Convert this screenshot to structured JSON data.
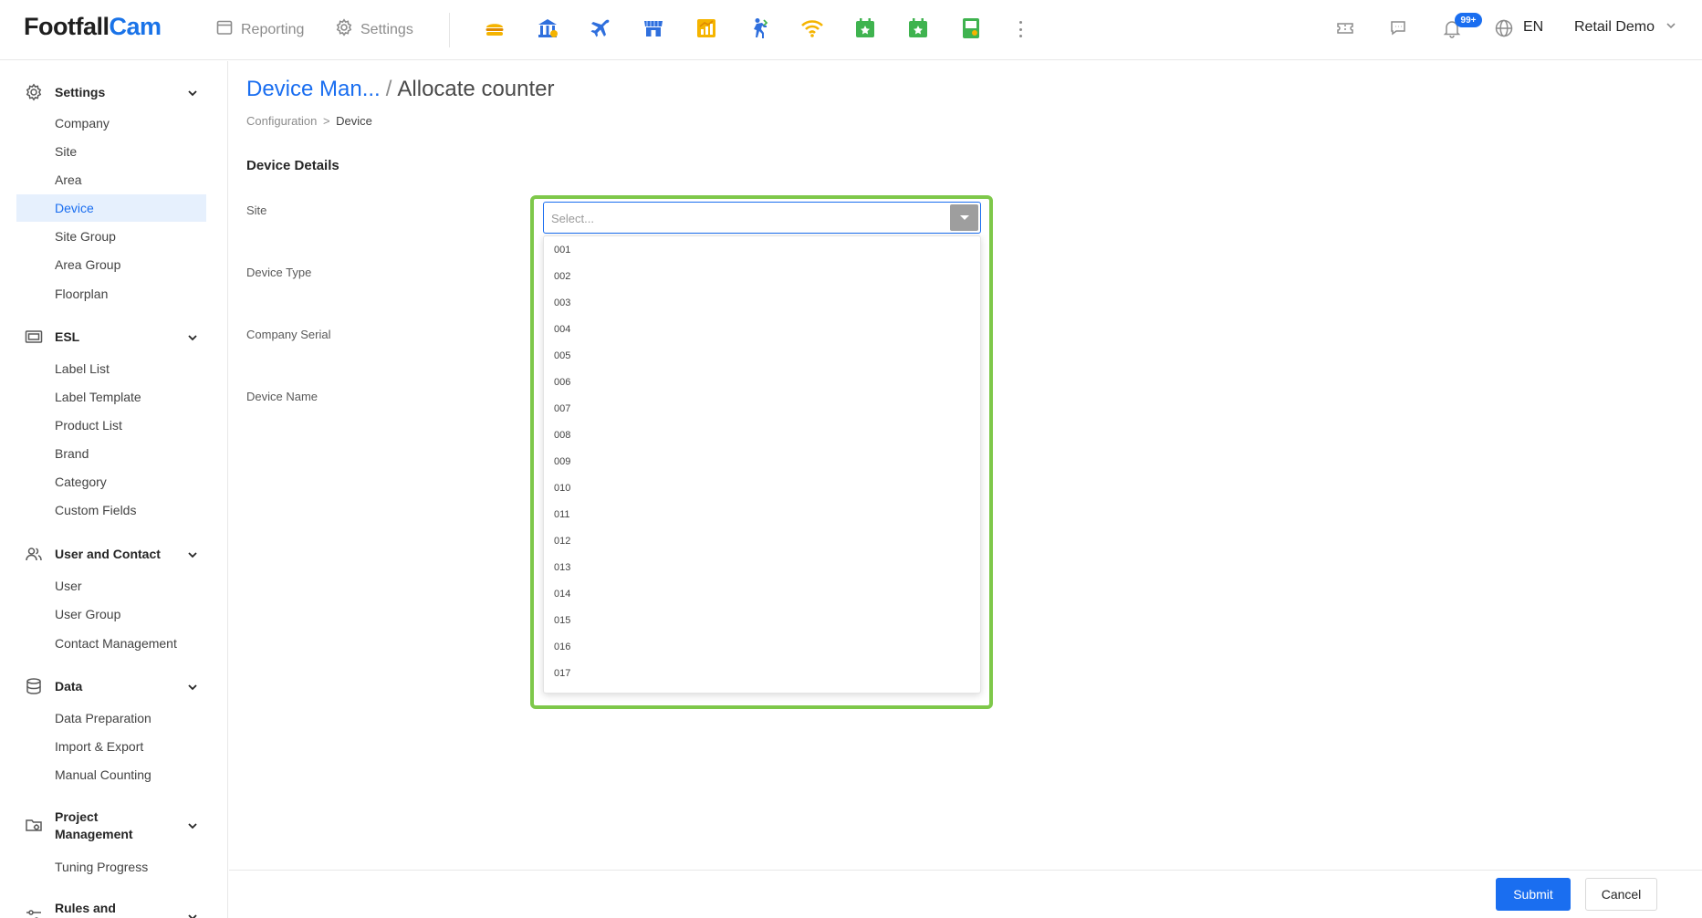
{
  "brand": {
    "part1": "Footfall",
    "part2": "Cam"
  },
  "topnav": {
    "reporting": "Reporting",
    "settings": "Settings"
  },
  "app_icons": [
    "burger-app-icon",
    "bank-app-icon",
    "airplane-app-icon",
    "store-app-icon",
    "chart-app-icon",
    "person-counter-app-icon",
    "wifi-app-icon",
    "calendar-app-icon",
    "calendar-star-app-icon",
    "kiosk-app-icon"
  ],
  "header": {
    "notification_count": "99+",
    "language": "EN",
    "user_name": "Retail Demo"
  },
  "sidebar": {
    "groups": [
      {
        "label": "Settings",
        "icon": "gear-icon",
        "items": [
          "Company",
          "Site",
          "Area",
          "Device",
          "Site Group",
          "Area Group",
          "Floorplan"
        ]
      },
      {
        "label": "ESL",
        "icon": "esl-label-icon",
        "items": [
          "Label List",
          "Label Template",
          "Product List",
          "Brand",
          "Category",
          "Custom Fields"
        ]
      },
      {
        "label": "User and Contact",
        "icon": "users-icon",
        "items": [
          "User",
          "User Group",
          "Contact Management"
        ]
      },
      {
        "label": "Data",
        "icon": "database-icon",
        "items": [
          "Data Preparation",
          "Import & Export",
          "Manual Counting"
        ]
      },
      {
        "label_line1": "Project",
        "label_line2": "Management",
        "icon": "project-icon",
        "items": [
          "Tuning Progress"
        ]
      },
      {
        "label": "Rules and",
        "icon": "sliders-icon",
        "items": []
      }
    ],
    "active_item": "Device"
  },
  "page": {
    "title_link": "Device Man...",
    "title_sep": "/",
    "title_current": "Allocate counter",
    "breadcrumb": {
      "first": "Configuration",
      "sep": ">",
      "last": "Device"
    },
    "section_title": "Device Details",
    "fields": {
      "site": "Site",
      "device_type": "Device Type",
      "company_serial": "Company Serial",
      "device_name": "Device Name"
    },
    "site_select": {
      "placeholder": "Select...",
      "options": [
        "001",
        "002",
        "003",
        "004",
        "005",
        "006",
        "007",
        "008",
        "009",
        "010",
        "011",
        "012",
        "013",
        "014",
        "015",
        "016",
        "017"
      ]
    }
  },
  "footer": {
    "submit": "Submit",
    "cancel": "Cancel"
  },
  "colors": {
    "accent": "#1a6ef0",
    "focus_frame": "#7ec84a",
    "active_bg": "#e6f0fd"
  }
}
